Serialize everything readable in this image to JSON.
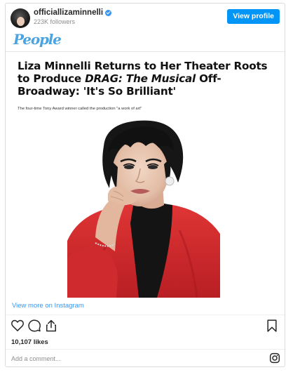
{
  "header": {
    "username": "officiallizaminnelli",
    "followers": "223K followers",
    "view_profile_label": "View profile",
    "verified": true
  },
  "media": {
    "brand_logo": "People",
    "headline_part1": "Liza Minnelli Returns to Her Theater Roots to Produce ",
    "headline_italic": "DRAG: The Musical",
    "headline_part2": " Off-Broadway: 'It's So Brilliant'",
    "subhead": "The four-time Tony Award winner called the production \"a work of art\""
  },
  "footer": {
    "view_more_label": "View more on Instagram",
    "likes": "10,107 likes",
    "comment_placeholder": "Add a comment..."
  },
  "icons": {
    "like": "heart-icon",
    "comment": "comment-icon",
    "share": "share-icon",
    "save": "bookmark-icon",
    "instagram": "instagram-icon"
  },
  "colors": {
    "button_blue": "#0095f6",
    "link_blue": "#3897f0",
    "people_logo": "#4ba3e0",
    "jacket_red": "#d72a2a"
  }
}
